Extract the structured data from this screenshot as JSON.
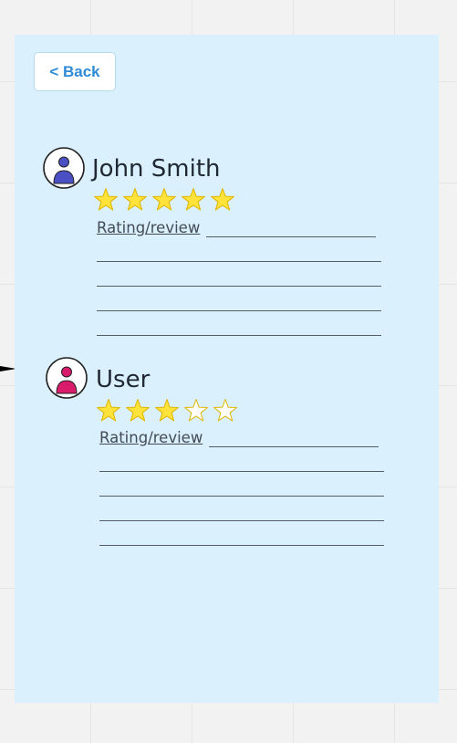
{
  "back_button": {
    "label": "< Back"
  },
  "reviews": [
    {
      "name": "John Smith",
      "rating": 5,
      "max_rating": 5,
      "review_label": "Rating/review",
      "avatar_color": "#4b4fc4"
    },
    {
      "name": "User",
      "rating": 3,
      "max_rating": 5,
      "review_label": "Rating/review",
      "avatar_color": "#d81b6a"
    }
  ],
  "colors": {
    "panel": "#daf0fd",
    "star_fill": "#ffe23a",
    "star_stroke": "#e0b400",
    "back_text": "#2f8bd6"
  }
}
